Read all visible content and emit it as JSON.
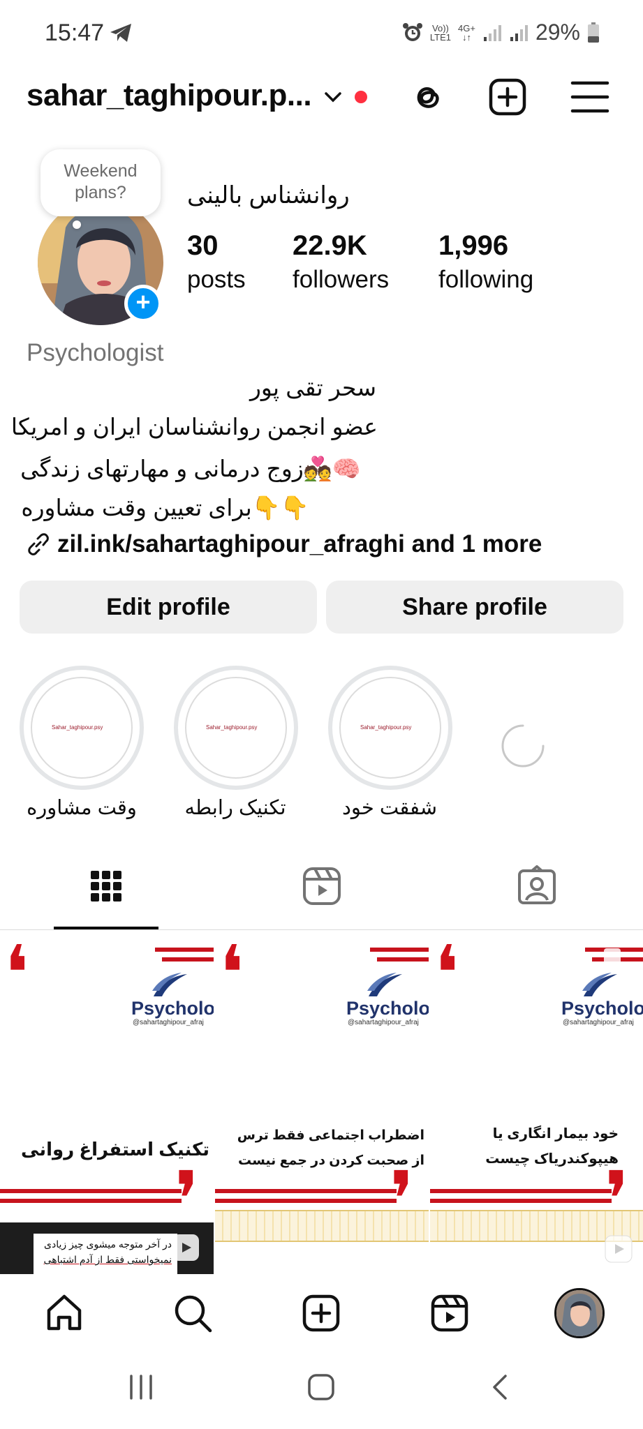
{
  "status_bar": {
    "time": "15:47",
    "telegram_icon": "send-icon",
    "volte": "Vo))",
    "lte": "LTE1",
    "network": "4G+",
    "battery": "29%"
  },
  "header": {
    "username": "sahar_taghipour.p...",
    "icons": [
      "chevron-down-icon",
      "threads-icon",
      "new-post-icon",
      "menu-icon"
    ]
  },
  "note": {
    "text_line1": "Weekend",
    "text_line2": "plans?"
  },
  "profile": {
    "full_name": "روانشناس بالینی",
    "stats": [
      {
        "value": "30",
        "label": "posts"
      },
      {
        "value": "22.9K",
        "label": "followers"
      },
      {
        "value": "1,996",
        "label": "following"
      }
    ],
    "category": "Psychologist",
    "bio_lines": [
      "سحر تقی پور",
      "عضو انجمن روانشناسان ایران و امریکا",
      "🧠💑زوج درمانی و مهارتهای زندگی",
      "👇👇برای تعیین وقت مشاوره"
    ],
    "link": "zil.ink/sahartaghipour_afraghi and 1 more"
  },
  "buttons": {
    "edit": "Edit profile",
    "share": "Share profile"
  },
  "highlights": [
    {
      "label": "وقت مشاوره",
      "logo": "Sahar_taghipour.psy"
    },
    {
      "label": "تکنیک رابطه",
      "logo": "Sahar_taghipour.psy"
    },
    {
      "label": "شفقت خود",
      "logo": "Sahar_taghipour.psy"
    }
  ],
  "posts": [
    {
      "brand": "Psycholog",
      "handle": "@sahartaghipour_afraj",
      "title1": "تکنیک استفراغ روانی",
      "title2": ""
    },
    {
      "brand": "Psycholog",
      "handle": "@sahartaghipour_afraj",
      "title1": "اضطراب اجتماعی فقط ترس",
      "title2": "از صحبت کردن در جمع نیست"
    },
    {
      "brand": "Psycholog",
      "handle": "@sahartaghipour_afraj",
      "title1": "خود بیمار انگاری  یا",
      "title2": "هیپوکندریاک چیست"
    }
  ],
  "reel_caption": {
    "line1": "در آخر متوجه میشوی چیز زیادی",
    "line2": "نمیخواستی فقط از آدم اشتباهی"
  },
  "colors": {
    "accent_blue": "#0095f6",
    "notification_red": "#ff3040",
    "brand_red": "#c7131d",
    "brand_navy": "#21336b"
  }
}
